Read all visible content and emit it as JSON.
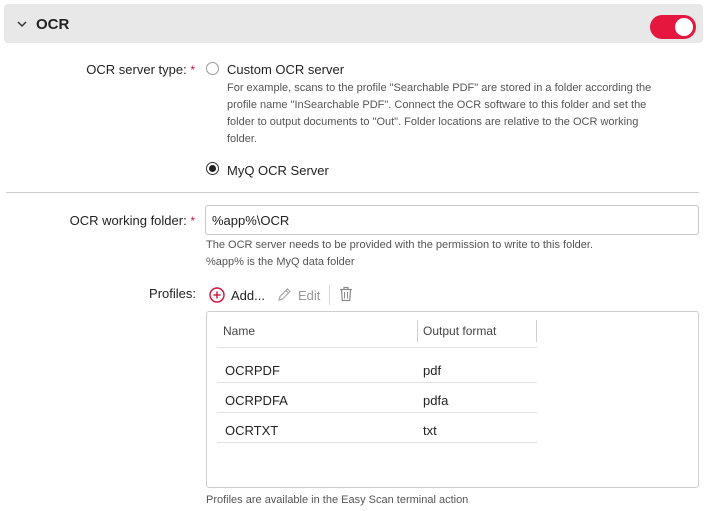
{
  "section": {
    "title": "OCR",
    "enabled": true
  },
  "server_type": {
    "label": "OCR server type:",
    "required_mark": "*",
    "options": [
      {
        "label": "Custom OCR server",
        "selected": false,
        "help_lines": [
          "For example, scans to the profile \"Searchable PDF\" are stored in a folder according the",
          "profile name \"InSearchable PDF\". Connect the OCR software to this folder and set the",
          "folder to output documents to \"Out\". Folder locations are relative to the OCR working",
          "folder."
        ]
      },
      {
        "label": "MyQ OCR Server",
        "selected": true
      }
    ]
  },
  "working_folder": {
    "label": "OCR working folder:",
    "required_mark": "*",
    "value": "%app%\\OCR",
    "help_lines": [
      "The OCR server needs to be provided with the permission to write to this folder.",
      "%app% is the MyQ data folder"
    ]
  },
  "profiles": {
    "label": "Profiles:",
    "toolbar": {
      "add_label": "Add...",
      "edit_label": "Edit"
    },
    "columns": [
      "Name",
      "Output format"
    ],
    "rows": [
      {
        "name": "OCRPDF",
        "format": "pdf"
      },
      {
        "name": "OCRPDFA",
        "format": "pdfa"
      },
      {
        "name": "OCRTXT",
        "format": "txt"
      }
    ],
    "footer_help": "Profiles are available in the Easy Scan terminal action"
  },
  "colors": {
    "accent": "#e5173f",
    "header_bg": "#e8e8e8"
  },
  "icons": {
    "header": "chevron-down-icon",
    "add": "plus-circle-icon",
    "edit": "pencil-icon",
    "delete": "trash-icon"
  }
}
